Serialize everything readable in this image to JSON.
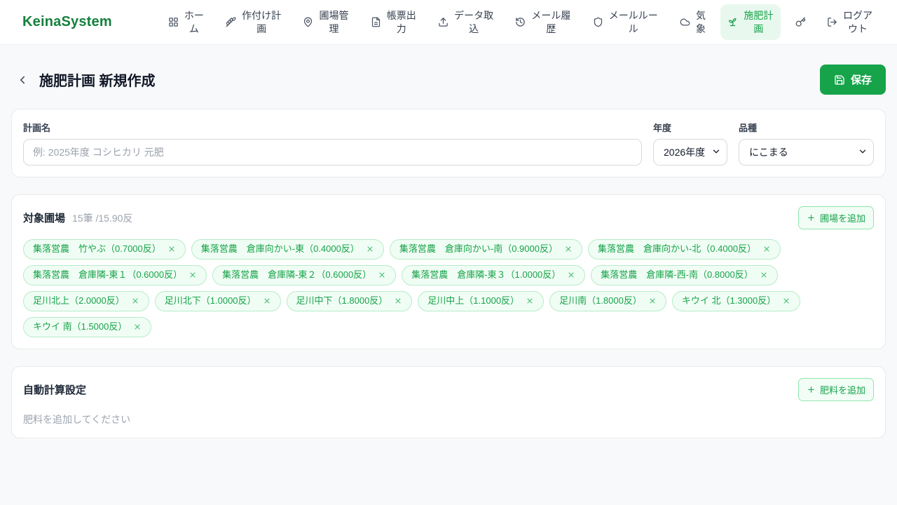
{
  "colors": {
    "accent": "#16a34a",
    "brand_text": "#15803d",
    "active_nav_bg": "#e9f8ef",
    "tag_bg": "#f0fdf4",
    "tag_border": "#b6ecc8",
    "page_bg": "#f8f9fa"
  },
  "brand": {
    "name": "KeinaSystem"
  },
  "nav": {
    "items": [
      {
        "label": "ホーム",
        "icon": "grid-icon",
        "active": false
      },
      {
        "label": "作付け計画",
        "icon": "wheat-icon",
        "active": false
      },
      {
        "label": "圃場管理",
        "icon": "map-pin-icon",
        "active": false
      },
      {
        "label": "帳票出力",
        "icon": "document-icon",
        "active": false
      },
      {
        "label": "データ取込",
        "icon": "upload-icon",
        "active": false
      },
      {
        "label": "メール履歴",
        "icon": "history-icon",
        "active": false
      },
      {
        "label": "メールルール",
        "icon": "shield-icon",
        "active": false
      },
      {
        "label": "気象",
        "icon": "cloud-icon",
        "active": false
      },
      {
        "label": "施肥計画",
        "icon": "sprout-icon",
        "active": true
      },
      {
        "label": "",
        "icon": "key-icon",
        "active": false
      },
      {
        "label": "ログアウト",
        "icon": "logout-icon",
        "active": false
      }
    ]
  },
  "page": {
    "title": "施肥計画 新規作成",
    "save_label": "保存"
  },
  "plan_form": {
    "name_label": "計画名",
    "name_placeholder": "例: 2025年度 コシヒカリ 元肥",
    "year_label": "年度",
    "year_value": "2026年度",
    "variety_label": "品種",
    "variety_value": "にこまる"
  },
  "fields_section": {
    "title": "対象圃場",
    "summary": "15筆 /15.90反",
    "add_button": "圃場を追加",
    "tags": [
      {
        "label": "集落営農　竹やぶ（0.7000反）"
      },
      {
        "label": "集落営農　倉庫向かい-東（0.4000反）"
      },
      {
        "label": "集落営農　倉庫向かい-南（0.9000反）"
      },
      {
        "label": "集落営農　倉庫向かい-北（0.4000反）"
      },
      {
        "label": "集落営農　倉庫隣-東１（0.6000反）"
      },
      {
        "label": "集落営農　倉庫隣-東２（0.6000反）"
      },
      {
        "label": "集落営農　倉庫隣-東３（1.0000反）"
      },
      {
        "label": "集落営農　倉庫隣-西-南（0.8000反）"
      },
      {
        "label": "足川北上（2.0000反）"
      },
      {
        "label": "足川北下（1.0000反）"
      },
      {
        "label": "足川中下（1.8000反）"
      },
      {
        "label": "足川中上（1.1000反）"
      },
      {
        "label": "足川南（1.8000反）"
      },
      {
        "label": "キウイ 北（1.3000反）"
      },
      {
        "label": "キウイ 南（1.5000反）"
      }
    ]
  },
  "auto_calc_section": {
    "title": "自動計算設定",
    "add_button": "肥料を追加",
    "empty_text": "肥料を追加してください"
  }
}
